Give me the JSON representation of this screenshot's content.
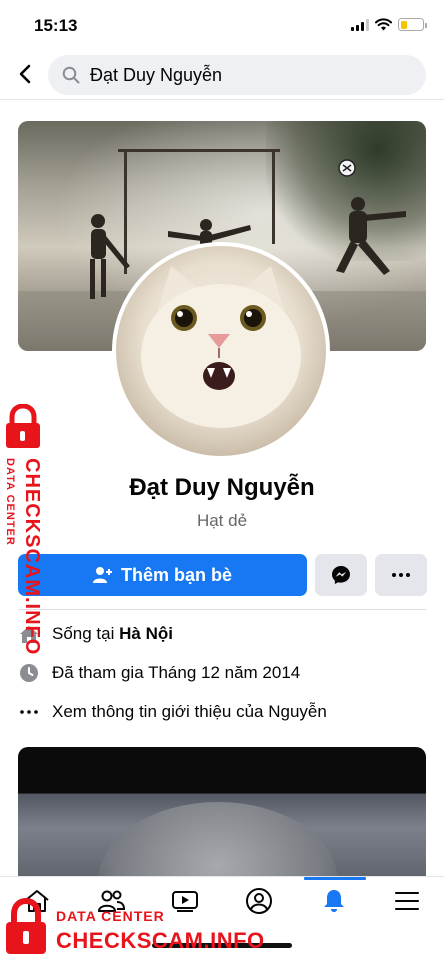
{
  "status_bar": {
    "time": "15:13",
    "battery_level": 0.3
  },
  "search": {
    "query": "Đạt Duy Nguyễn"
  },
  "profile": {
    "name": "Đạt Duy Nguyễn",
    "nickname": "Hạt dẻ"
  },
  "actions": {
    "add_friend_label": "Thêm bạn bè"
  },
  "intro": {
    "lives_in_prefix": "Sống tại ",
    "lives_in_city": "Hà Nội",
    "joined": "Đã tham gia Tháng 12 năm 2014",
    "see_about": "Xem thông tin giới thiệu của Nguyễn"
  },
  "bottom_nav": {
    "items": [
      "home-icon",
      "friends-icon",
      "watch-icon",
      "profile-icon",
      "notifications-icon",
      "menu-icon"
    ],
    "active": "notifications-icon"
  },
  "watermark": {
    "sub": "DATA CENTER",
    "brand": "CHECKSCAM.INFO"
  },
  "colors": {
    "accent": "#1877f2",
    "watermark": "#e8141c",
    "secondary_text": "#65676b",
    "button_gray": "#e4e6eb"
  }
}
